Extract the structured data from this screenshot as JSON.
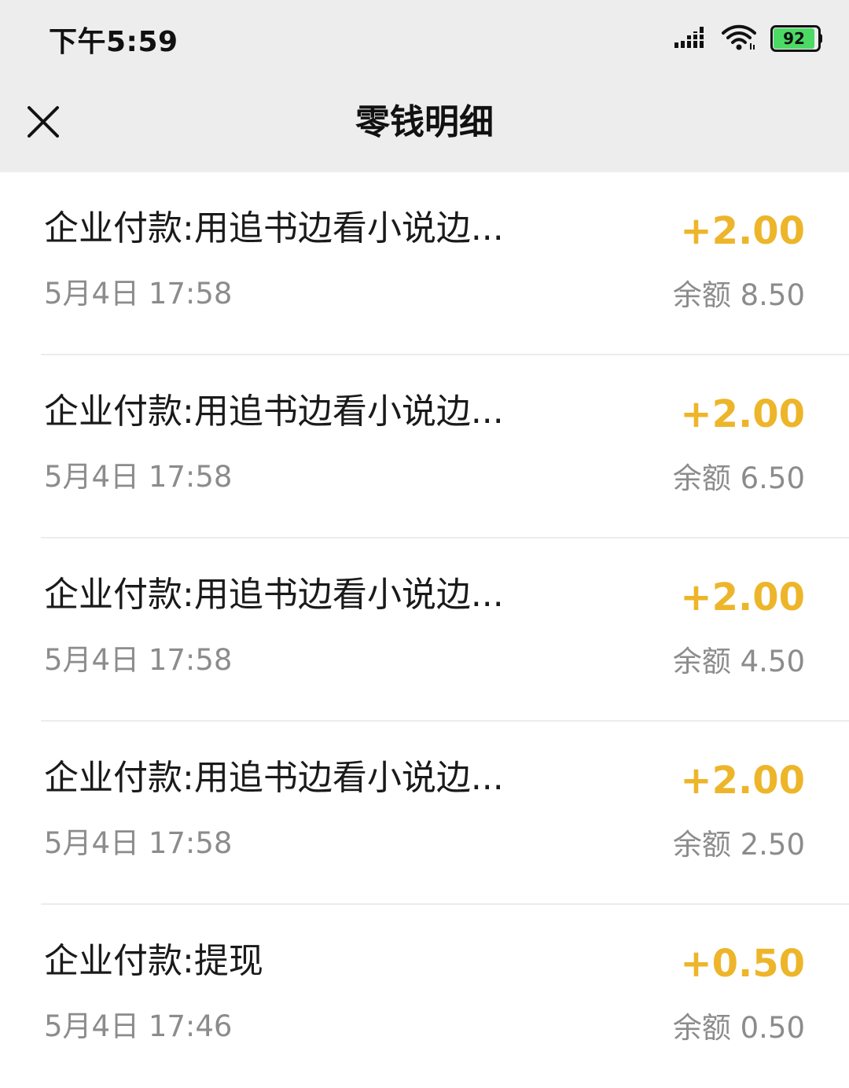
{
  "status_bar": {
    "time": "下午5:59",
    "battery_level": "92",
    "icons": [
      "signal-icon",
      "wifi-icon",
      "battery-icon"
    ]
  },
  "header": {
    "title": "零钱明细",
    "close_icon": "close-icon"
  },
  "colors": {
    "header_background": "#ededed",
    "amount": "#edb52a",
    "secondary_text": "#8c8c8c",
    "battery_fill": "#4cd964"
  },
  "transactions": [
    {
      "title": "企业付款:用追书边看小说边...",
      "time": "5月4日 17:58",
      "amount": "+2.00",
      "balance": "余额 8.50"
    },
    {
      "title": "企业付款:用追书边看小说边...",
      "time": "5月4日 17:58",
      "amount": "+2.00",
      "balance": "余额 6.50"
    },
    {
      "title": "企业付款:用追书边看小说边...",
      "time": "5月4日 17:58",
      "amount": "+2.00",
      "balance": "余额 4.50"
    },
    {
      "title": "企业付款:用追书边看小说边...",
      "time": "5月4日 17:58",
      "amount": "+2.00",
      "balance": "余额 2.50"
    },
    {
      "title": "企业付款:提现",
      "time": "5月4日 17:46",
      "amount": "+0.50",
      "balance": "余额 0.50"
    }
  ]
}
